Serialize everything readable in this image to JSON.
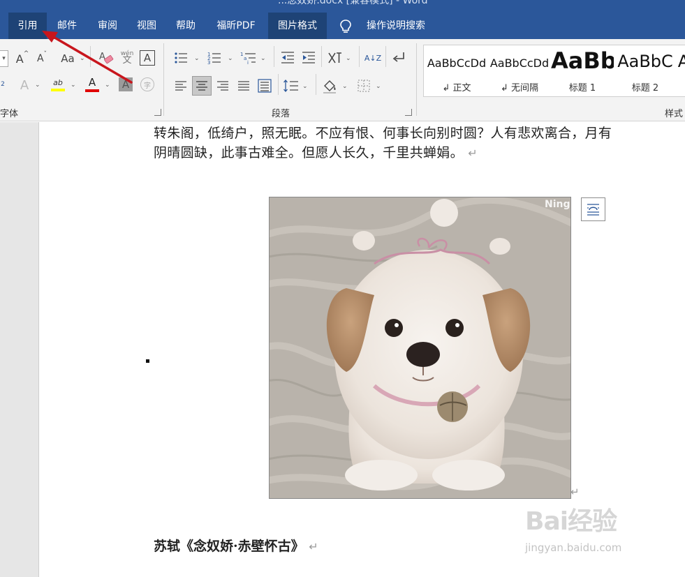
{
  "window": {
    "title": "...念奴娇.docx [兼容模式] - Word"
  },
  "tabs": [
    {
      "label": "引用"
    },
    {
      "label": "邮件"
    },
    {
      "label": "审阅"
    },
    {
      "label": "视图"
    },
    {
      "label": "帮助"
    },
    {
      "label": "福昕PDF"
    },
    {
      "label": "图片格式"
    },
    {
      "label": "操作说明搜索"
    }
  ],
  "ribbon": {
    "groups": {
      "font": "字体",
      "paragraph": "段落",
      "styles": "样式"
    },
    "font_buttons": {
      "grow": "A",
      "shrink": "A",
      "case": "Aa",
      "phonetic": "wén",
      "phonetic_sub": "文",
      "border_char": "A",
      "text_effect": "A",
      "highlight": "ab",
      "font_color": "A",
      "shading_char": "A",
      "enclose_char": "字"
    },
    "sort_label": "A↓Z",
    "styles": [
      {
        "sample": "AaBbCcDd",
        "name": "↲ 正文"
      },
      {
        "sample": "AaBbCcDd",
        "name": "↲ 无间隔"
      },
      {
        "sample": "AaBb",
        "name": "标题 1"
      },
      {
        "sample": "AaBbC",
        "name": "标题 2"
      },
      {
        "sample": "A",
        "name": ""
      }
    ]
  },
  "colors": {
    "accent": "#2b579a",
    "highlight_bar": "#ffff00",
    "font_color_bar": "#e00000",
    "arrow": "#c8161d"
  },
  "document": {
    "lines": [
      "转朱阁，低绮户，照无眠。不应有恨、何事长向别时圆？人有悲欢离合，月有",
      "阴晴圆缺，此事古难全。但愿人长久，千里共蝉娟。"
    ],
    "heading": "苏轼《念奴娇·赤壁怀古》",
    "para_mark": "↵",
    "picture_watermark": "Ning"
  },
  "watermark": {
    "brand": "Bai经验",
    "url": "jingyan.baidu.com"
  }
}
